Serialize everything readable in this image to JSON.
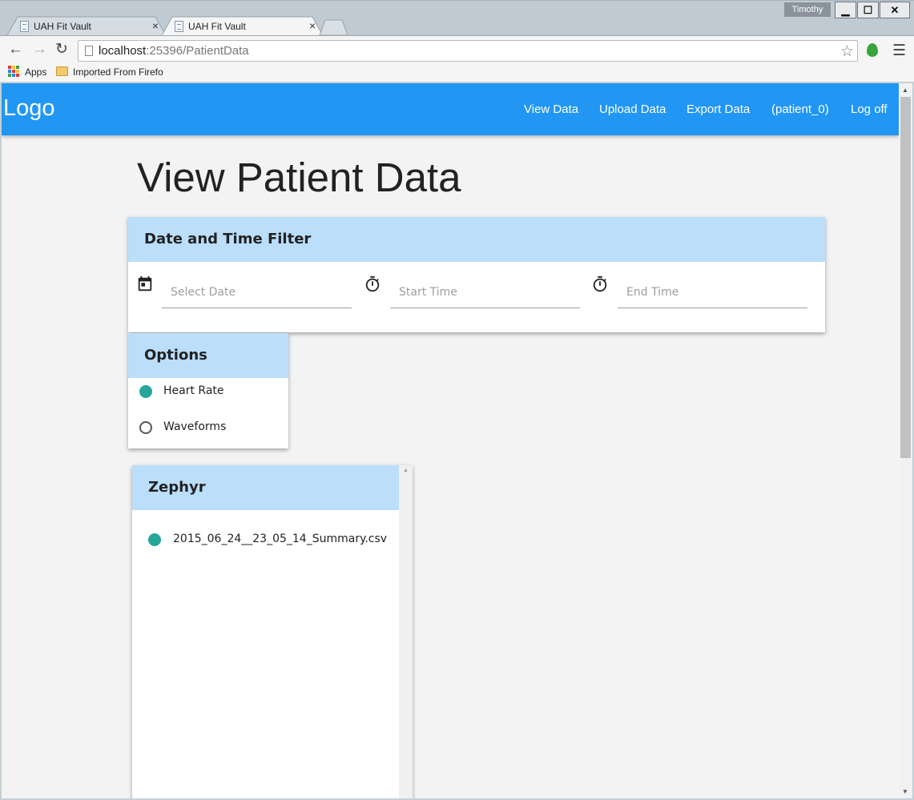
{
  "browser": {
    "user": "Timothy",
    "window_controls": {
      "minimize": "▁",
      "maximize": "☐",
      "close": "✕"
    },
    "tabs": [
      {
        "title": "UAH Fit Vault",
        "close": "×"
      },
      {
        "title": "UAH Fit Vault",
        "close": "×"
      }
    ],
    "address": {
      "host": "localhost",
      "rest": ":25396/PatientData"
    },
    "bookmarks": {
      "apps": "Apps",
      "folder": "Imported From Firefo"
    }
  },
  "appbar": {
    "logo": "Logo",
    "nav": [
      "View Data",
      "Upload Data",
      "Export Data",
      "(patient_0)",
      "Log off"
    ]
  },
  "page": {
    "title": "View Patient Data"
  },
  "filter_card": {
    "title": "Date and Time Filter",
    "fields": [
      {
        "placeholder": "Select Date",
        "icon": "calendar-icon"
      },
      {
        "placeholder": "Start Time",
        "icon": "stopwatch-icon"
      },
      {
        "placeholder": "End Time",
        "icon": "stopwatch-icon"
      }
    ]
  },
  "options_card": {
    "title": "Options",
    "items": [
      {
        "label": "Heart Rate",
        "selected": true
      },
      {
        "label": "Waveforms",
        "selected": false
      }
    ]
  },
  "zephyr_card": {
    "title": "Zephyr",
    "files": [
      {
        "name": "2015_06_24__23_05_14_Summary.csv",
        "selected": true
      }
    ]
  },
  "colors": {
    "appbar": "#2196f3",
    "card_header": "#bbdefb",
    "radio_selected": "#26a69a"
  }
}
